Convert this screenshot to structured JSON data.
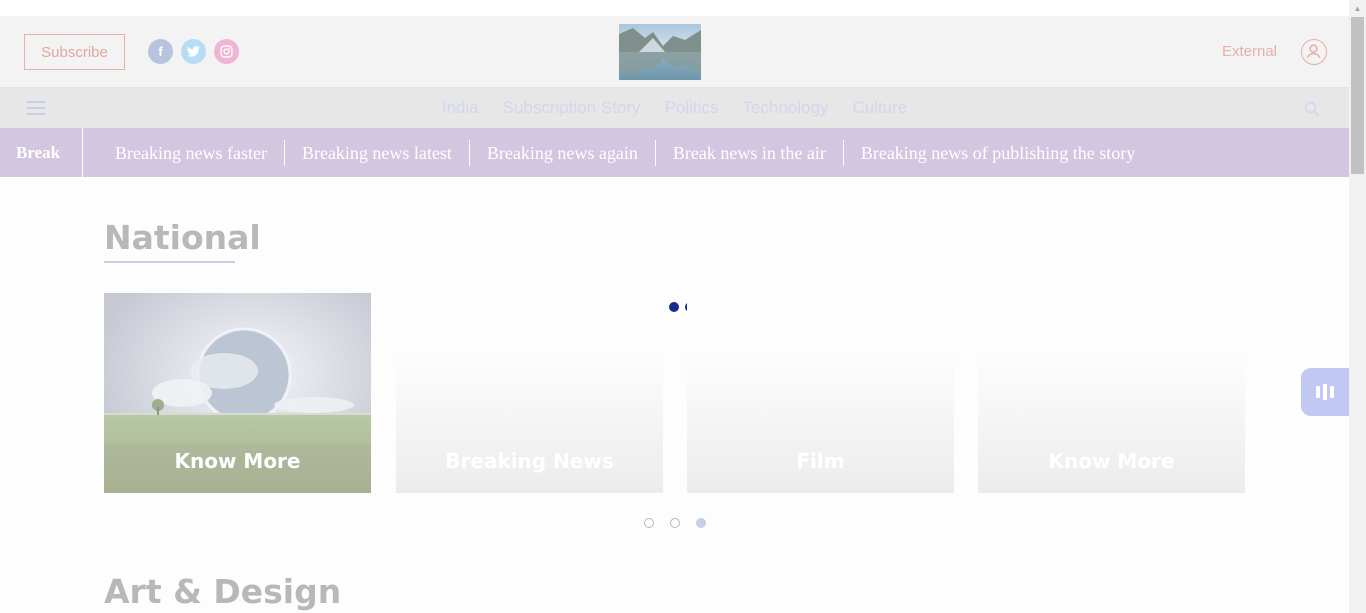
{
  "header": {
    "subscribe_label": "Subscribe",
    "social": [
      {
        "icon": "facebook-icon",
        "glyph": "f",
        "color": "#b8c3de"
      },
      {
        "icon": "twitter-icon",
        "glyph": "t",
        "color": "#b7dcf6"
      },
      {
        "icon": "instagram-icon",
        "glyph": "◎",
        "color": "#efb5d4"
      }
    ],
    "external_label": "External"
  },
  "nav": {
    "items": [
      "India",
      "Subscription Story",
      "Politics",
      "Technology",
      "Culture"
    ]
  },
  "ticker": {
    "label": "Break",
    "items": [
      "Breaking news faster",
      "Breaking news latest",
      "Breaking news again",
      "Break news in the air",
      "Breaking news of publishing the story"
    ]
  },
  "sections": {
    "national_title": "National",
    "art_title": "Art & Design"
  },
  "carousel": {
    "cards": [
      {
        "label": "Know More"
      },
      {
        "label": "Breaking News"
      },
      {
        "label": "Film"
      },
      {
        "label": "Know More"
      }
    ],
    "pages": 3,
    "active_page": 3
  },
  "colors": {
    "ticker_bg": "#d3c6e0",
    "loader": "#1a2b8a",
    "accent": "#e0a89f"
  }
}
